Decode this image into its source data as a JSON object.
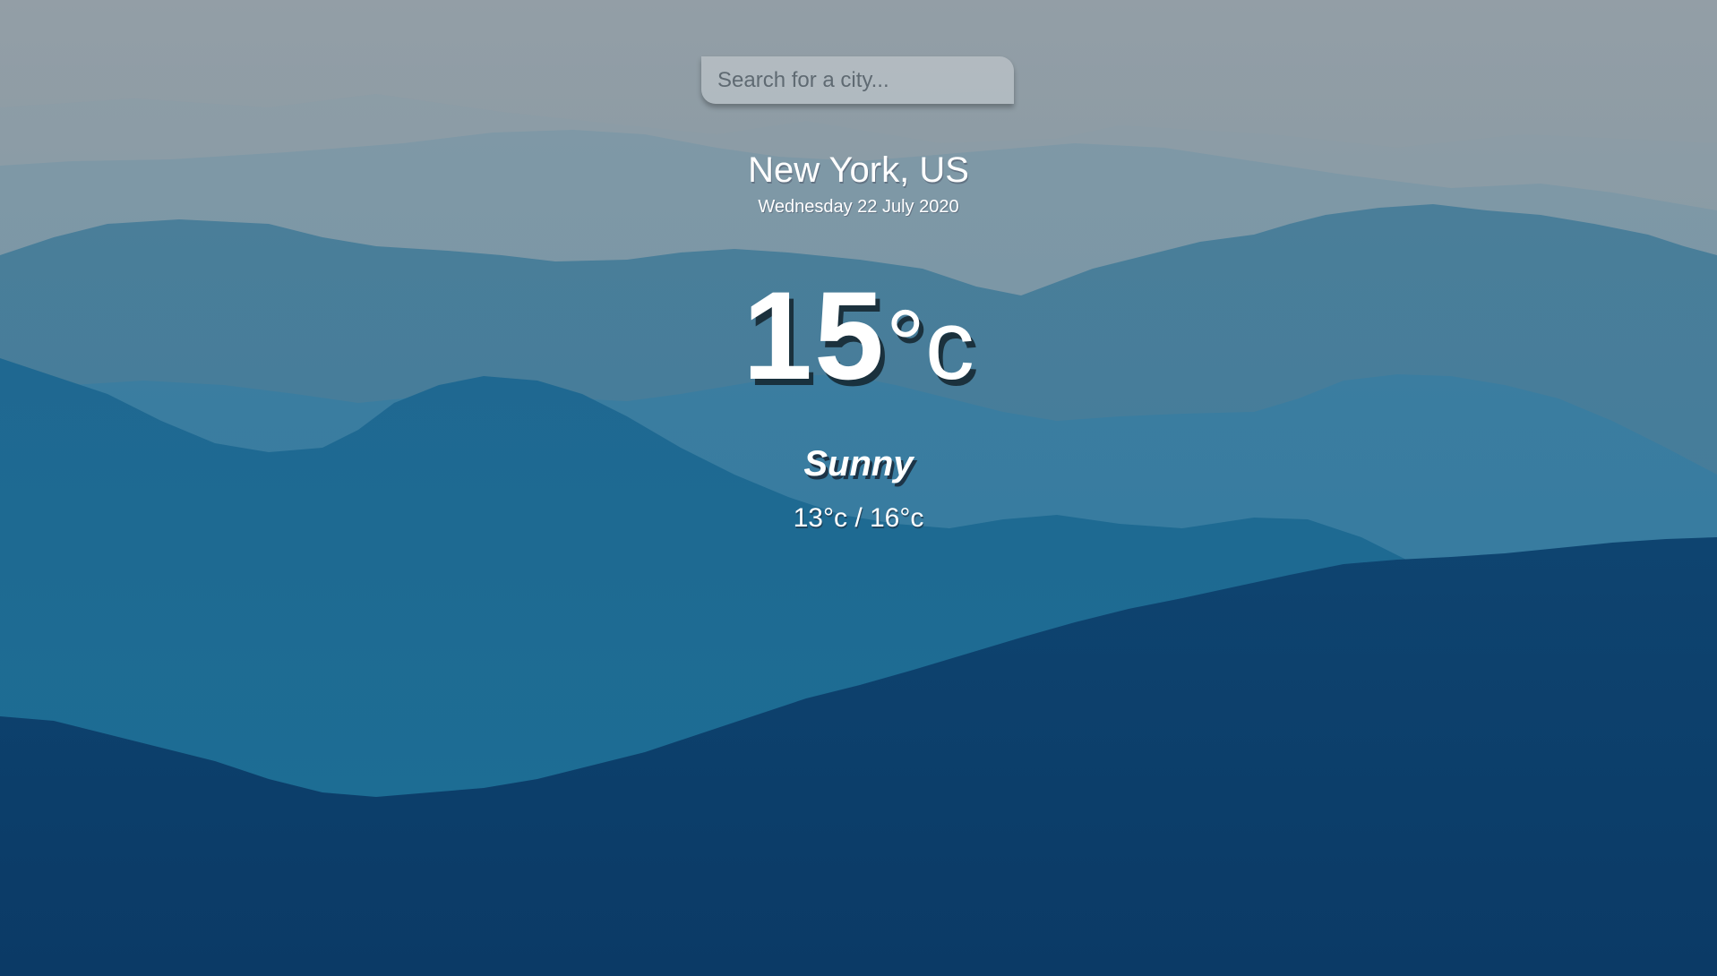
{
  "search": {
    "placeholder": "Search for a city...",
    "value": ""
  },
  "location": {
    "city": "New York, US",
    "date": "Wednesday 22 July 2020"
  },
  "current": {
    "temp": "15",
    "unit": "°c",
    "condition": "Sunny",
    "range": "13°c / 16°c"
  },
  "colors": {
    "sky": "#8f9da6",
    "far_hills": "#6f8e9f",
    "mid_hills": "#3f7a9c",
    "near_hills": "#236c94",
    "front_hill": "#0d3d69"
  }
}
